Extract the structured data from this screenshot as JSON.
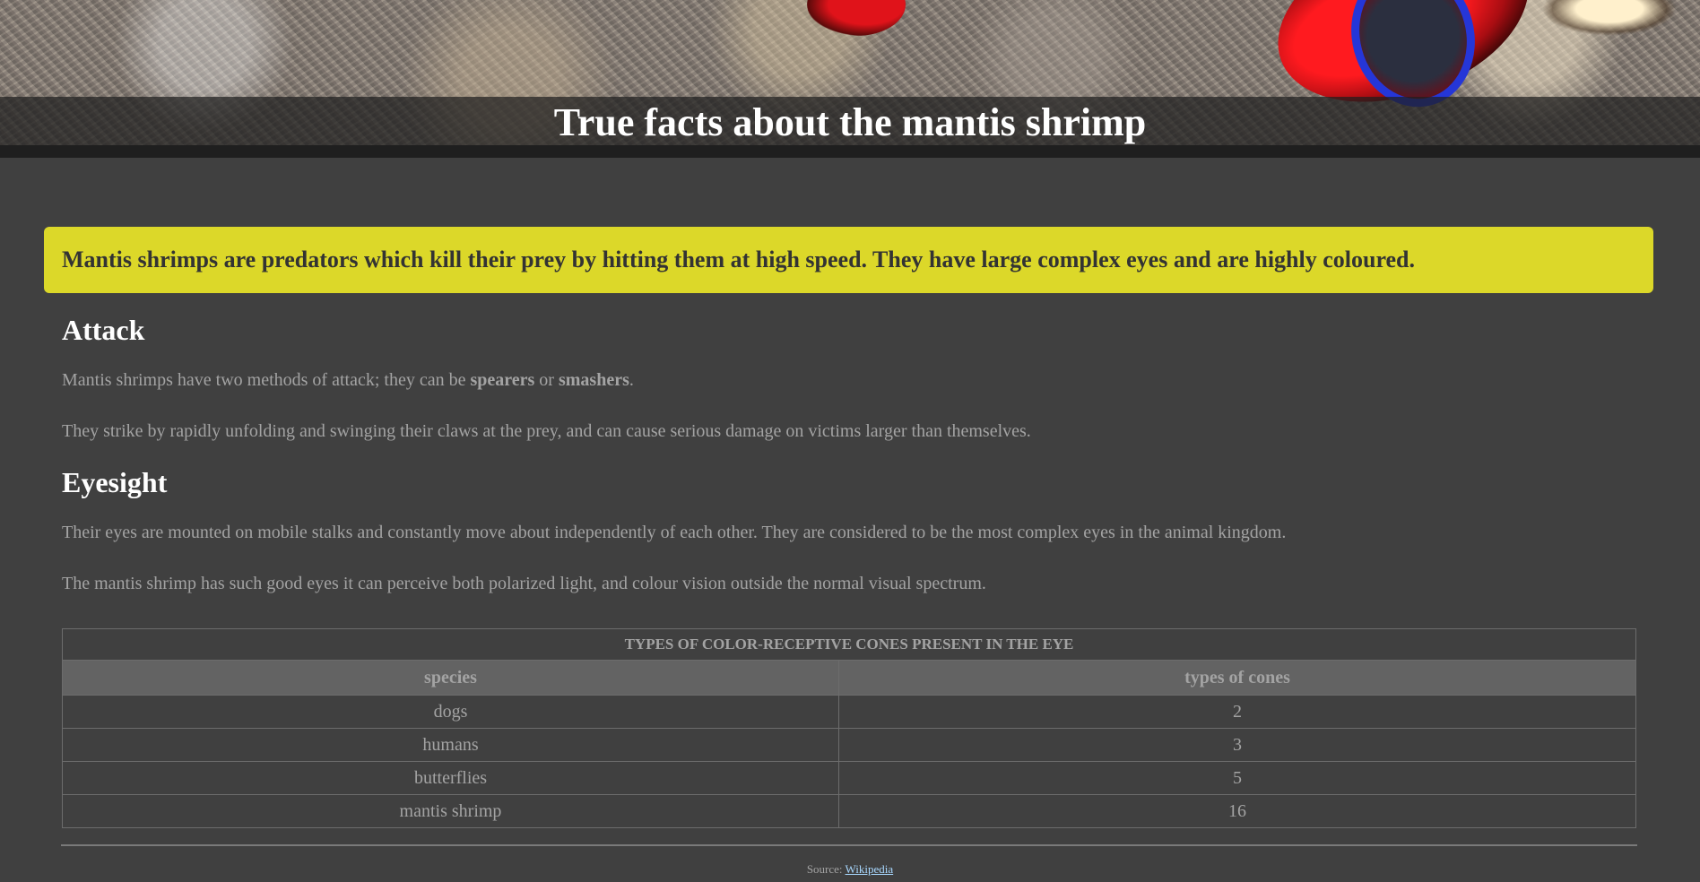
{
  "header": {
    "title": "True facts about the mantis shrimp"
  },
  "intro": {
    "text": "Mantis shrimps are predators which kill their prey by hitting them at high speed. They have large complex eyes and are highly coloured."
  },
  "sections": {
    "attack": {
      "heading": "Attack",
      "p1_before": "Mantis shrimps have two methods of attack; they can be ",
      "p1_bold1": "spearers",
      "p1_mid": " or ",
      "p1_bold2": "smashers",
      "p1_after": ".",
      "p2": "They strike by rapidly unfolding and swinging their claws at the prey, and can cause serious damage on victims larger than themselves."
    },
    "eyesight": {
      "heading": "Eyesight",
      "p1": "Their eyes are mounted on mobile stalks and constantly move about independently of each other. They are considered to be the most complex eyes in the animal kingdom.",
      "p2": "The mantis shrimp has such good eyes it can perceive both polarized light, and colour vision outside the normal visual spectrum."
    }
  },
  "table": {
    "caption": "TYPES OF COLOR-RECEPTIVE CONES PRESENT IN THE EYE",
    "headers": [
      "species",
      "types of cones"
    ],
    "rows": [
      [
        "dogs",
        "2"
      ],
      [
        "humans",
        "3"
      ],
      [
        "butterflies",
        "5"
      ],
      [
        "mantis shrimp",
        "16"
      ]
    ]
  },
  "footer": {
    "source_label": "Source:",
    "link_text": "Wikipedia"
  },
  "colors": {
    "page_background": "#404040",
    "callout_background": "#dcd829",
    "heading_text": "#ffffff",
    "body_text": "#a3a3a3",
    "table_header_background": "#636363",
    "link": "#a8d8ff"
  }
}
